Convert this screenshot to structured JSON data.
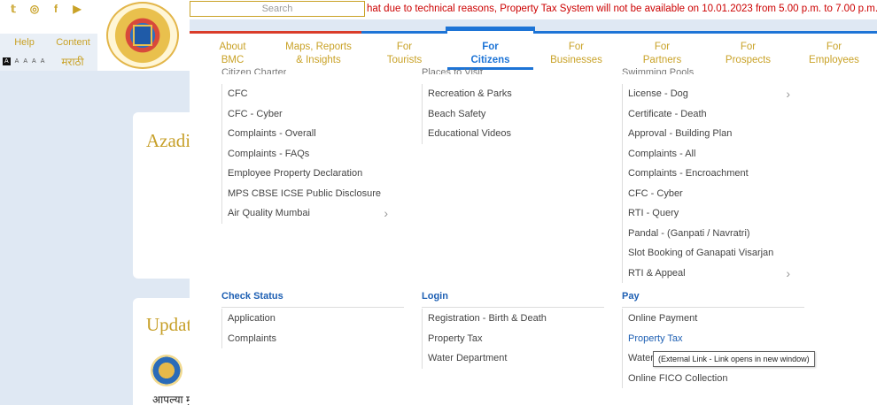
{
  "header": {
    "search_placeholder": "Search",
    "ticker": "hat due to technical reasons, Property Tax System will not be available on 10.01.2023 from 5.00 p.m. to 7.00 p.m. Inconvenie"
  },
  "social_icons": [
    "twitter-icon",
    "instagram-icon",
    "facebook-icon",
    "youtube-icon"
  ],
  "leftnav": {
    "help": "Help",
    "content": "Content",
    "font_sizes": [
      "A",
      "A",
      "A",
      "A",
      "A"
    ],
    "marathi": "मराठी"
  },
  "mainnav": [
    {
      "line1": "About",
      "line2": "BMC"
    },
    {
      "line1": "Maps, Reports",
      "line2": "& Insights"
    },
    {
      "line1": "For",
      "line2": "Tourists"
    },
    {
      "line1": "For",
      "line2": "Citizens"
    },
    {
      "line1": "For",
      "line2": "Businesses"
    },
    {
      "line1": "For",
      "line2": "Partners"
    },
    {
      "line1": "For",
      "line2": "Prospects"
    },
    {
      "line1": "For",
      "line2": "Employees"
    }
  ],
  "background": {
    "card1_title": "Azadi",
    "card2_title": "Updat",
    "marathi_text": "आपल्या मु"
  },
  "menu": {
    "col1_cut": "Citizen Charter",
    "col2_cut": "Places to Visit",
    "col3_cut": "Swimming Pools",
    "col1": [
      "CFC",
      "CFC - Cyber",
      "Complaints - Overall",
      "Complaints - FAQs",
      "Employee Property Declaration",
      "MPS CBSE ICSE Public Disclosure",
      "Air Quality Mumbai"
    ],
    "col2": [
      "Recreation & Parks",
      "Beach Safety",
      "Educational Videos"
    ],
    "col3": [
      "License - Dog",
      "Certificate - Death",
      "Approval - Building Plan",
      "Complaints - All",
      "Complaints - Encroachment",
      "CFC - Cyber",
      "RTI - Query",
      "Pandal - (Ganpati / Navratri)",
      "Slot Booking of Ganapati Visarjan",
      "RTI & Appeal"
    ]
  },
  "sections": {
    "check_status": {
      "title": "Check Status",
      "items": [
        "Application",
        "Complaints"
      ]
    },
    "login": {
      "title": "Login",
      "items": [
        "Registration - Birth & Death",
        "Property Tax",
        "Water Department"
      ]
    },
    "pay": {
      "title": "Pay",
      "items": [
        "Online Payment",
        "Property Tax",
        "Water",
        "Online FICO Collection"
      ]
    }
  },
  "tooltip": "(External Link - Link opens in new window)",
  "colors": {
    "gold": "#c9a227",
    "blue": "#1d74d6",
    "red": "#d93c2a",
    "ticker": "#cc0000"
  }
}
